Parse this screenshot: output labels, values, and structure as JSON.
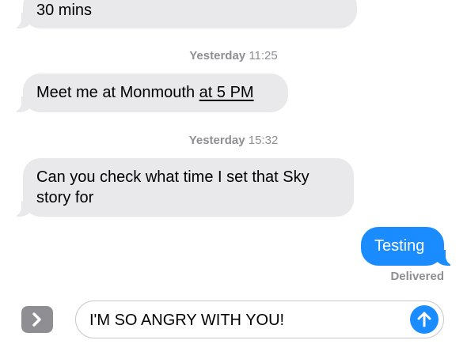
{
  "messages": [
    {
      "sender": "other",
      "text": "30 mins"
    },
    {
      "sender": "other",
      "timestamp_day": "Yesterday",
      "timestamp_time": "11:25",
      "text_plain": "Meet me at Monmouth ",
      "text_link": "at 5 PM"
    },
    {
      "sender": "other",
      "timestamp_day": "Yesterday",
      "timestamp_time": "15:32",
      "text_line1": "Can you check what time I set that Sky",
      "text_line2": "story for"
    },
    {
      "sender": "me",
      "text": "Testing",
      "status": "Delivered"
    }
  ],
  "composer": {
    "value": "I'M SO ANGRY WITH YOU!",
    "expand_icon": "chevron-right-icon",
    "send_icon": "arrow-up-icon"
  },
  "colors": {
    "incoming_bubble": "#e9e9eb",
    "outgoing_bubble": "#1a8cff",
    "meta_text": "#8e8e93"
  }
}
